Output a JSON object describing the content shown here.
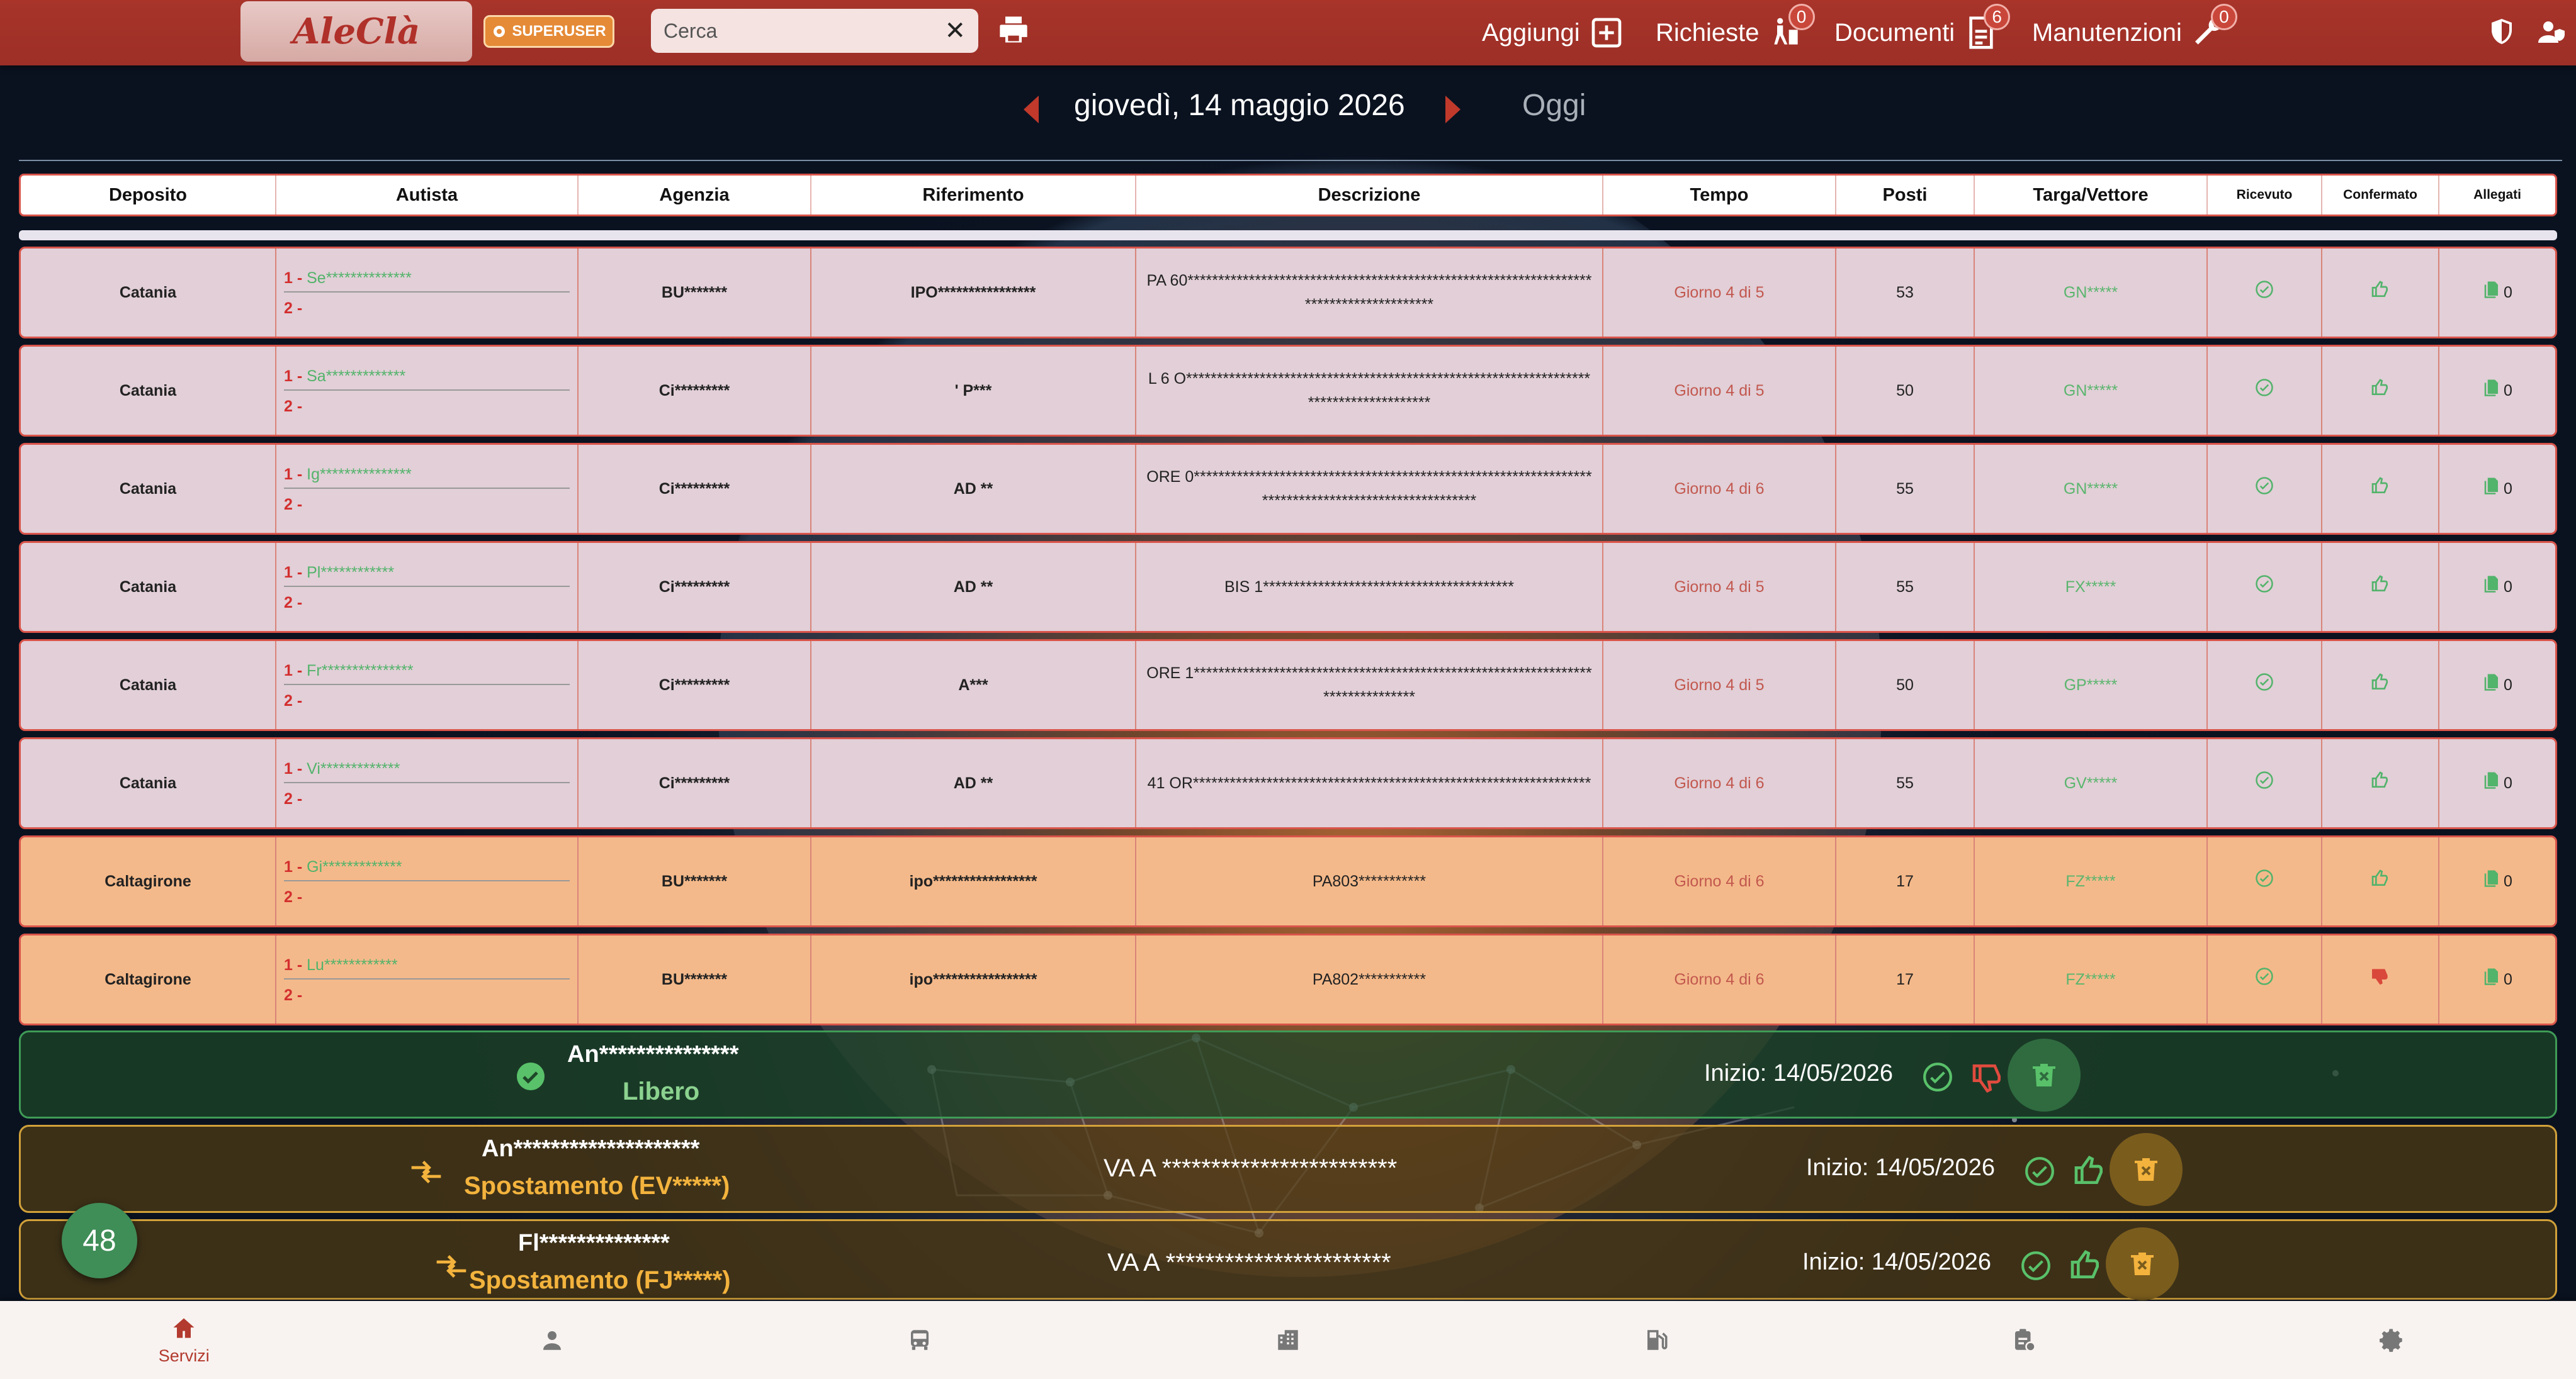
{
  "header": {
    "logo_text": "AleClà",
    "superuser_label": "SUPERUSER",
    "search_placeholder": "Cerca",
    "nav": [
      {
        "label": "Aggiungi",
        "icon": "add-box-icon",
        "badge": ""
      },
      {
        "label": "Richieste",
        "icon": "hand-cart-icon",
        "badge": "0"
      },
      {
        "label": "Documenti",
        "icon": "document-icon",
        "badge": "6"
      },
      {
        "label": "Manutenzioni",
        "icon": "wrench-icon",
        "badge": "0"
      }
    ]
  },
  "datebar": {
    "date": "giovedì, 14 maggio 2026",
    "today_label": "Oggi"
  },
  "table": {
    "columns": [
      "Deposito",
      "Autista",
      "Agenzia",
      "Riferimento",
      "Descrizione",
      "Tempo",
      "Posti",
      "Targa/Vettore",
      "Ricevuto",
      "Confermato",
      "Allegati"
    ],
    "rows": [
      {
        "deposito": "Catania",
        "autista1_n": "1 - ",
        "autista1": "Se**************",
        "autista2": "2 -",
        "agenzia": "BU*******",
        "riferimento": "IPO****************",
        "descrizione": "PA 60***************************************************************************************",
        "tempo": "Giorno 4 di 5",
        "posti": "53",
        "targa": "GN*****",
        "allegati": "0",
        "confermato": "up",
        "style": "pink"
      },
      {
        "deposito": "Catania",
        "autista1_n": "1 - ",
        "autista1": "Sa*************",
        "autista2": "2 -",
        "agenzia": "Ci*********",
        "riferimento": "' P***",
        "descrizione": "L 6 O**************************************************************************************",
        "tempo": "Giorno 4 di 5",
        "posti": "50",
        "targa": "GN*****",
        "allegati": "0",
        "confermato": "up",
        "style": "pink"
      },
      {
        "deposito": "Catania",
        "autista1_n": "1 - ",
        "autista1": "Ig***************",
        "autista2": "2 -",
        "agenzia": "Ci*********",
        "riferimento": "AD **",
        "descrizione": "ORE 0****************************************************************************************************",
        "tempo": "Giorno 4 di 6",
        "posti": "55",
        "targa": "GN*****",
        "allegati": "0",
        "confermato": "up",
        "style": "pink"
      },
      {
        "deposito": "Catania",
        "autista1_n": "1 - ",
        "autista1": "Pl************",
        "autista2": "2 -",
        "agenzia": "Ci*********",
        "riferimento": "AD **",
        "descrizione": "BIS 1*****************************************",
        "tempo": "Giorno 4 di 5",
        "posti": "55",
        "targa": "FX*****",
        "allegati": "0",
        "confermato": "up",
        "style": "pink"
      },
      {
        "deposito": "Catania",
        "autista1_n": "1 - ",
        "autista1": "Fr***************",
        "autista2": "2 -",
        "agenzia": "Ci*********",
        "riferimento": "A***",
        "descrizione": "ORE 1********************************************************************************",
        "tempo": "Giorno 4 di 5",
        "posti": "50",
        "targa": "GP*****",
        "allegati": "0",
        "confermato": "up",
        "style": "pink"
      },
      {
        "deposito": "Catania",
        "autista1_n": "1 - ",
        "autista1": "Vi*************",
        "autista2": "2 -",
        "agenzia": "Ci*********",
        "riferimento": "AD **",
        "descrizione": "41 OR*****************************************************************",
        "tempo": "Giorno 4 di 6",
        "posti": "55",
        "targa": "GV*****",
        "allegati": "0",
        "confermato": "up",
        "style": "pink"
      },
      {
        "deposito": "Caltagirone",
        "autista1_n": "1 - ",
        "autista1": "Gi*************",
        "autista2": "2 -",
        "agenzia": "BU*******",
        "riferimento": "ipo*****************",
        "descrizione": "PA803***********",
        "tempo": "Giorno 4 di 6",
        "posti": "17",
        "targa": "FZ*****",
        "allegati": "0",
        "confermato": "up",
        "style": "orange"
      },
      {
        "deposito": "Caltagirone",
        "autista1_n": "1 - ",
        "autista1": "Lu************",
        "autista2": "2 -",
        "agenzia": "BU*******",
        "riferimento": "ipo*****************",
        "descrizione": "PA802***********",
        "tempo": "Giorno 4 di 6",
        "posti": "17",
        "targa": "FZ*****",
        "allegati": "0",
        "confermato": "down",
        "style": "orange"
      }
    ]
  },
  "status_bars": [
    {
      "name": "An***************",
      "kind": "Libero",
      "description": "",
      "inizio": "Inizio: 14/05/2026",
      "color": "#8bd28f",
      "style": "green"
    },
    {
      "name": "An********************",
      "kind": "Spostamento (EV*****)",
      "description": "VA A ************************",
      "inizio": "Inizio: 14/05/2026",
      "color": "#f3b33d",
      "style": "gold"
    },
    {
      "name": "Fl**************",
      "kind": "Spostamento (FJ*****)",
      "description": "VA A ***********************",
      "inizio": "Inizio: 14/05/2026",
      "color": "#f3b33d",
      "style": "gold"
    }
  ],
  "fab_count": "48",
  "bottom_nav": [
    {
      "label": "Servizi",
      "icon": "home-icon"
    },
    {
      "label": "",
      "icon": "person-icon"
    },
    {
      "label": "",
      "icon": "bus-icon"
    },
    {
      "label": "",
      "icon": "building-icon"
    },
    {
      "label": "",
      "icon": "fuel-icon"
    },
    {
      "label": "",
      "icon": "clipboard-icon"
    },
    {
      "label": "",
      "icon": "settings-icon"
    }
  ],
  "colors": {
    "header": "#a8342a",
    "accent": "#c0392b",
    "green": "#52b36b",
    "pink_row": "#e2cfd7",
    "orange_row": "#f4b98a"
  }
}
